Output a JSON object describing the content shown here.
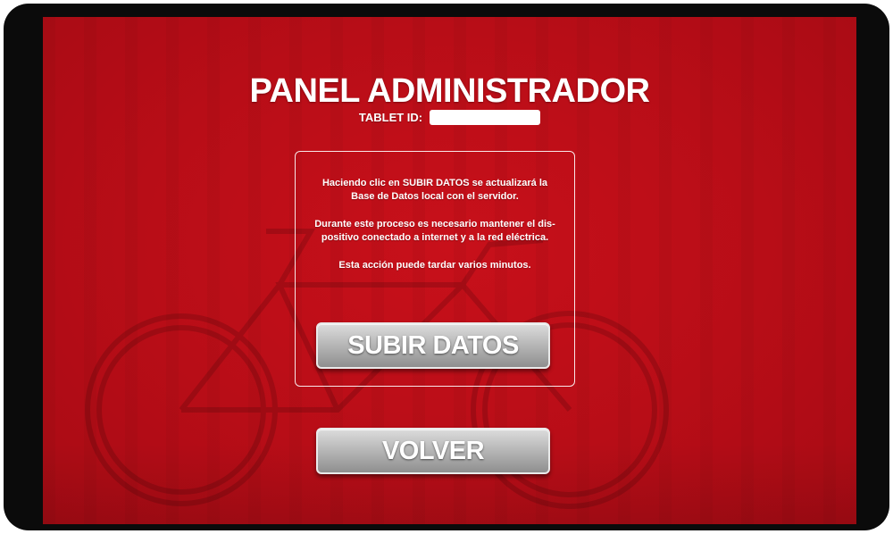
{
  "header": {
    "title": "PANEL ADMINISTRADOR",
    "tablet_id_label": "TABLET ID:",
    "tablet_id_value": ""
  },
  "info": {
    "paragraphs": [
      "Haciendo clic en SUBIR DATOS se actualizará la\nBase de Datos local con el servidor.",
      "Durante este proceso es necesario mantener el dis-\npositivo conectado a internet y a la red eléctrica.",
      "Esta acción puede tardar varios minutos."
    ]
  },
  "buttons": {
    "upload_label": "SUBIR DATOS",
    "back_label": "VOLVER"
  },
  "colors": {
    "background_red": "#b80d17",
    "button_gray": "#bdbdbd",
    "text": "#ffffff"
  }
}
